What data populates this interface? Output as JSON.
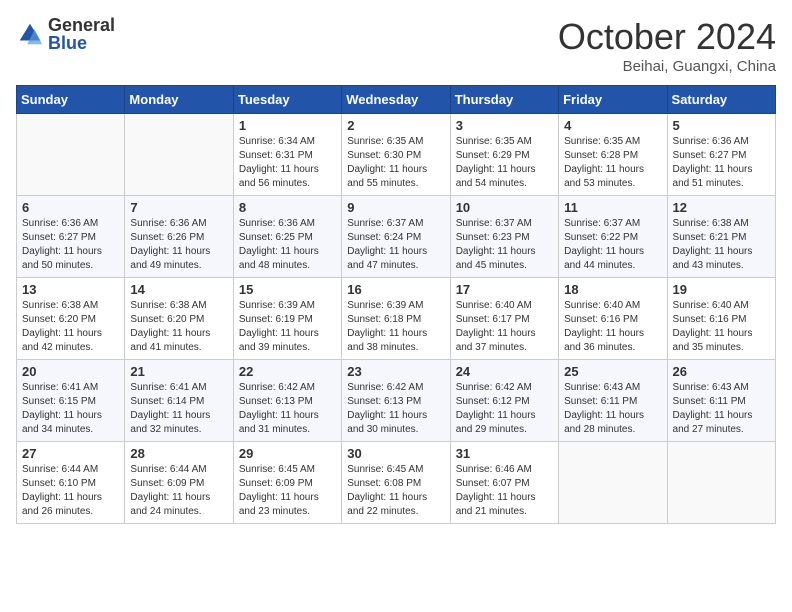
{
  "header": {
    "logo_general": "General",
    "logo_blue": "Blue",
    "month_title": "October 2024",
    "location": "Beihai, Guangxi, China"
  },
  "weekdays": [
    "Sunday",
    "Monday",
    "Tuesday",
    "Wednesday",
    "Thursday",
    "Friday",
    "Saturday"
  ],
  "weeks": [
    [
      {
        "day": "",
        "sunrise": "",
        "sunset": "",
        "daylight": ""
      },
      {
        "day": "",
        "sunrise": "",
        "sunset": "",
        "daylight": ""
      },
      {
        "day": "1",
        "sunrise": "Sunrise: 6:34 AM",
        "sunset": "Sunset: 6:31 PM",
        "daylight": "Daylight: 11 hours and 56 minutes."
      },
      {
        "day": "2",
        "sunrise": "Sunrise: 6:35 AM",
        "sunset": "Sunset: 6:30 PM",
        "daylight": "Daylight: 11 hours and 55 minutes."
      },
      {
        "day": "3",
        "sunrise": "Sunrise: 6:35 AM",
        "sunset": "Sunset: 6:29 PM",
        "daylight": "Daylight: 11 hours and 54 minutes."
      },
      {
        "day": "4",
        "sunrise": "Sunrise: 6:35 AM",
        "sunset": "Sunset: 6:28 PM",
        "daylight": "Daylight: 11 hours and 53 minutes."
      },
      {
        "day": "5",
        "sunrise": "Sunrise: 6:36 AM",
        "sunset": "Sunset: 6:27 PM",
        "daylight": "Daylight: 11 hours and 51 minutes."
      }
    ],
    [
      {
        "day": "6",
        "sunrise": "Sunrise: 6:36 AM",
        "sunset": "Sunset: 6:27 PM",
        "daylight": "Daylight: 11 hours and 50 minutes."
      },
      {
        "day": "7",
        "sunrise": "Sunrise: 6:36 AM",
        "sunset": "Sunset: 6:26 PM",
        "daylight": "Daylight: 11 hours and 49 minutes."
      },
      {
        "day": "8",
        "sunrise": "Sunrise: 6:36 AM",
        "sunset": "Sunset: 6:25 PM",
        "daylight": "Daylight: 11 hours and 48 minutes."
      },
      {
        "day": "9",
        "sunrise": "Sunrise: 6:37 AM",
        "sunset": "Sunset: 6:24 PM",
        "daylight": "Daylight: 11 hours and 47 minutes."
      },
      {
        "day": "10",
        "sunrise": "Sunrise: 6:37 AM",
        "sunset": "Sunset: 6:23 PM",
        "daylight": "Daylight: 11 hours and 45 minutes."
      },
      {
        "day": "11",
        "sunrise": "Sunrise: 6:37 AM",
        "sunset": "Sunset: 6:22 PM",
        "daylight": "Daylight: 11 hours and 44 minutes."
      },
      {
        "day": "12",
        "sunrise": "Sunrise: 6:38 AM",
        "sunset": "Sunset: 6:21 PM",
        "daylight": "Daylight: 11 hours and 43 minutes."
      }
    ],
    [
      {
        "day": "13",
        "sunrise": "Sunrise: 6:38 AM",
        "sunset": "Sunset: 6:20 PM",
        "daylight": "Daylight: 11 hours and 42 minutes."
      },
      {
        "day": "14",
        "sunrise": "Sunrise: 6:38 AM",
        "sunset": "Sunset: 6:20 PM",
        "daylight": "Daylight: 11 hours and 41 minutes."
      },
      {
        "day": "15",
        "sunrise": "Sunrise: 6:39 AM",
        "sunset": "Sunset: 6:19 PM",
        "daylight": "Daylight: 11 hours and 39 minutes."
      },
      {
        "day": "16",
        "sunrise": "Sunrise: 6:39 AM",
        "sunset": "Sunset: 6:18 PM",
        "daylight": "Daylight: 11 hours and 38 minutes."
      },
      {
        "day": "17",
        "sunrise": "Sunrise: 6:40 AM",
        "sunset": "Sunset: 6:17 PM",
        "daylight": "Daylight: 11 hours and 37 minutes."
      },
      {
        "day": "18",
        "sunrise": "Sunrise: 6:40 AM",
        "sunset": "Sunset: 6:16 PM",
        "daylight": "Daylight: 11 hours and 36 minutes."
      },
      {
        "day": "19",
        "sunrise": "Sunrise: 6:40 AM",
        "sunset": "Sunset: 6:16 PM",
        "daylight": "Daylight: 11 hours and 35 minutes."
      }
    ],
    [
      {
        "day": "20",
        "sunrise": "Sunrise: 6:41 AM",
        "sunset": "Sunset: 6:15 PM",
        "daylight": "Daylight: 11 hours and 34 minutes."
      },
      {
        "day": "21",
        "sunrise": "Sunrise: 6:41 AM",
        "sunset": "Sunset: 6:14 PM",
        "daylight": "Daylight: 11 hours and 32 minutes."
      },
      {
        "day": "22",
        "sunrise": "Sunrise: 6:42 AM",
        "sunset": "Sunset: 6:13 PM",
        "daylight": "Daylight: 11 hours and 31 minutes."
      },
      {
        "day": "23",
        "sunrise": "Sunrise: 6:42 AM",
        "sunset": "Sunset: 6:13 PM",
        "daylight": "Daylight: 11 hours and 30 minutes."
      },
      {
        "day": "24",
        "sunrise": "Sunrise: 6:42 AM",
        "sunset": "Sunset: 6:12 PM",
        "daylight": "Daylight: 11 hours and 29 minutes."
      },
      {
        "day": "25",
        "sunrise": "Sunrise: 6:43 AM",
        "sunset": "Sunset: 6:11 PM",
        "daylight": "Daylight: 11 hours and 28 minutes."
      },
      {
        "day": "26",
        "sunrise": "Sunrise: 6:43 AM",
        "sunset": "Sunset: 6:11 PM",
        "daylight": "Daylight: 11 hours and 27 minutes."
      }
    ],
    [
      {
        "day": "27",
        "sunrise": "Sunrise: 6:44 AM",
        "sunset": "Sunset: 6:10 PM",
        "daylight": "Daylight: 11 hours and 26 minutes."
      },
      {
        "day": "28",
        "sunrise": "Sunrise: 6:44 AM",
        "sunset": "Sunset: 6:09 PM",
        "daylight": "Daylight: 11 hours and 24 minutes."
      },
      {
        "day": "29",
        "sunrise": "Sunrise: 6:45 AM",
        "sunset": "Sunset: 6:09 PM",
        "daylight": "Daylight: 11 hours and 23 minutes."
      },
      {
        "day": "30",
        "sunrise": "Sunrise: 6:45 AM",
        "sunset": "Sunset: 6:08 PM",
        "daylight": "Daylight: 11 hours and 22 minutes."
      },
      {
        "day": "31",
        "sunrise": "Sunrise: 6:46 AM",
        "sunset": "Sunset: 6:07 PM",
        "daylight": "Daylight: 11 hours and 21 minutes."
      },
      {
        "day": "",
        "sunrise": "",
        "sunset": "",
        "daylight": ""
      },
      {
        "day": "",
        "sunrise": "",
        "sunset": "",
        "daylight": ""
      }
    ]
  ]
}
